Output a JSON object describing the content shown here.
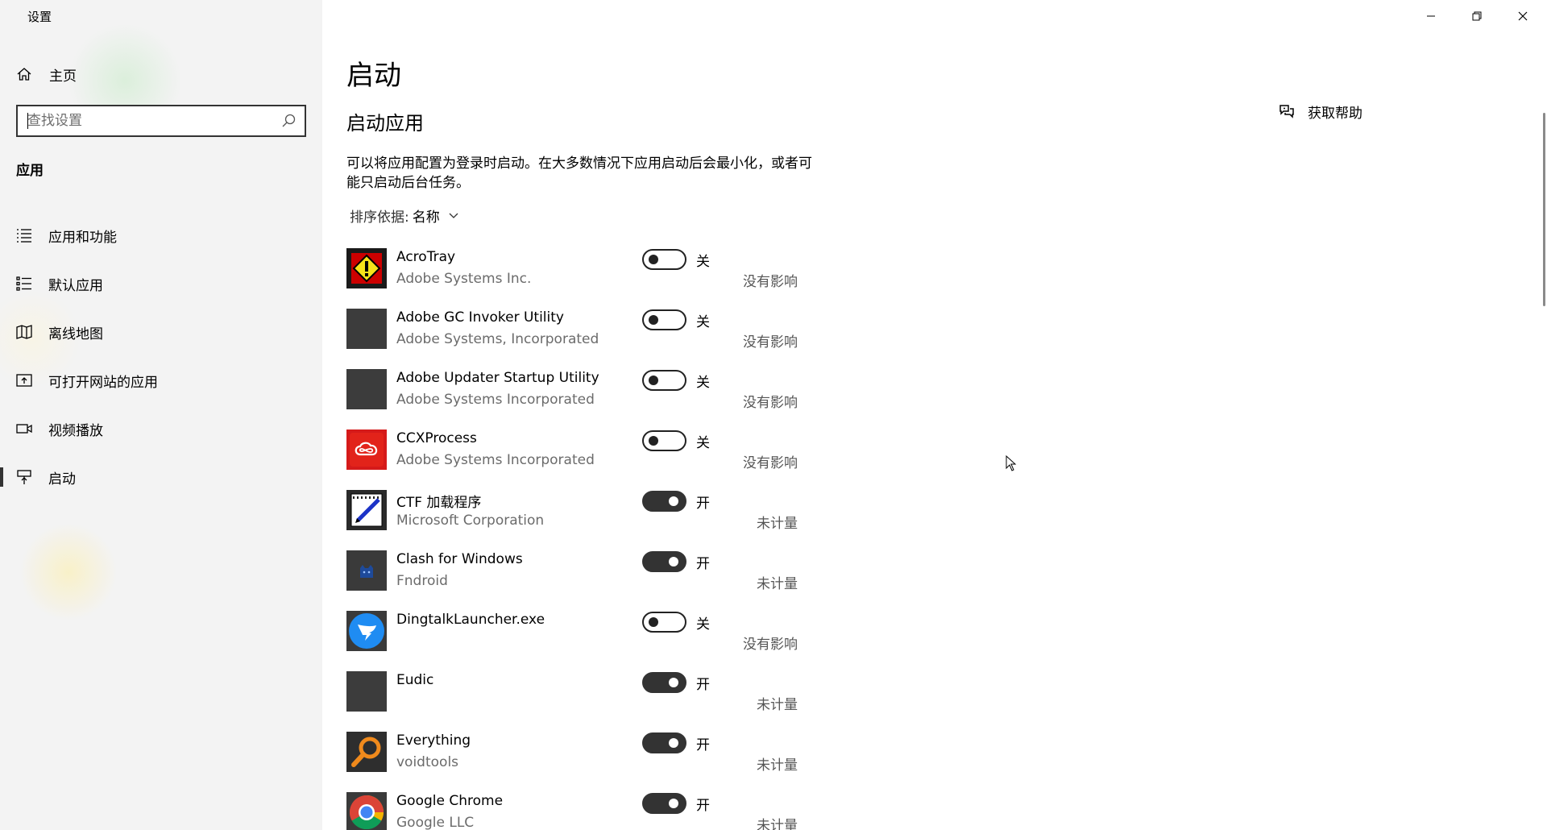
{
  "window": {
    "title": "设置"
  },
  "sidebar": {
    "home_label": "主页",
    "search_placeholder": "查找设置",
    "section_label": "应用",
    "items": [
      {
        "label": "应用和功能",
        "icon": "list-icon"
      },
      {
        "label": "默认应用",
        "icon": "default-apps-icon"
      },
      {
        "label": "离线地图",
        "icon": "map-icon"
      },
      {
        "label": "可打开网站的应用",
        "icon": "web-app-icon"
      },
      {
        "label": "视频播放",
        "icon": "video-icon"
      },
      {
        "label": "启动",
        "icon": "startup-icon",
        "active": true
      }
    ]
  },
  "main": {
    "title": "启动",
    "subtitle": "启动应用",
    "description": "可以将应用配置为登录时启动。在大多数情况下应用启动后会最小化，或者可能只启动后台任务。",
    "sort_label": "排序依据:",
    "sort_value": "名称",
    "help_label": "获取帮助",
    "apps": [
      {
        "name": "AcroTray",
        "publisher": "Adobe Systems Inc.",
        "state": "关",
        "on": false,
        "impact": "没有影响",
        "icon": "acrotray-icon"
      },
      {
        "name": "Adobe GC Invoker Utility",
        "publisher": "Adobe Systems, Incorporated",
        "state": "关",
        "on": false,
        "impact": "没有影响",
        "icon": "blank-app-icon"
      },
      {
        "name": "Adobe Updater Startup Utility",
        "publisher": "Adobe Systems Incorporated",
        "state": "关",
        "on": false,
        "impact": "没有影响",
        "icon": "blank-app-icon"
      },
      {
        "name": "CCXProcess",
        "publisher": "Adobe Systems Incorporated",
        "state": "关",
        "on": false,
        "impact": "没有影响",
        "icon": "creative-cloud-icon"
      },
      {
        "name": "CTF 加载程序",
        "publisher": "Microsoft Corporation",
        "state": "开",
        "on": true,
        "impact": "未计量",
        "icon": "ctf-loader-icon"
      },
      {
        "name": "Clash for Windows",
        "publisher": "Fndroid",
        "state": "开",
        "on": true,
        "impact": "未计量",
        "icon": "clash-cat-icon"
      },
      {
        "name": "DingtalkLauncher.exe",
        "publisher": "",
        "state": "关",
        "on": false,
        "impact": "没有影响",
        "icon": "dingtalk-icon"
      },
      {
        "name": "Eudic",
        "publisher": "",
        "state": "开",
        "on": true,
        "impact": "未计量",
        "icon": "blank-app-icon"
      },
      {
        "name": "Everything",
        "publisher": "voidtools",
        "state": "开",
        "on": true,
        "impact": "未计量",
        "icon": "everything-search-icon"
      },
      {
        "name": "Google Chrome",
        "publisher": "Google LLC",
        "state": "开",
        "on": true,
        "impact": "未计量",
        "icon": "chrome-icon"
      }
    ]
  }
}
